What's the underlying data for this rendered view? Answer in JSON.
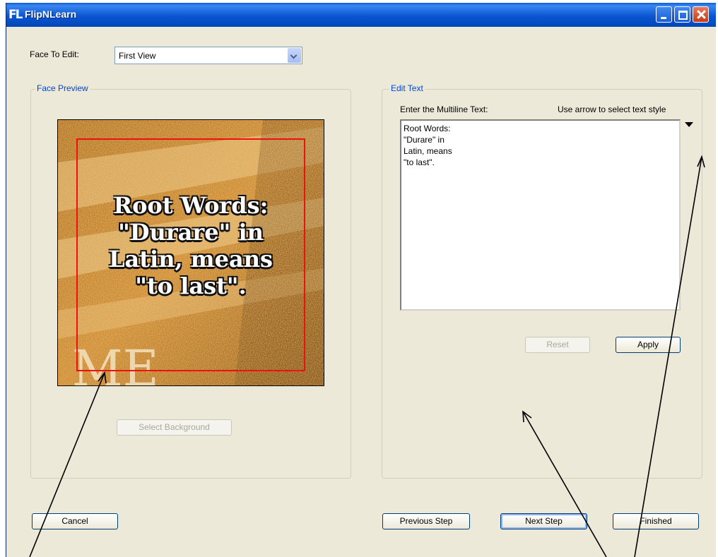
{
  "window": {
    "title": "FlipNLearn",
    "logo": "FL"
  },
  "face_to_edit": {
    "label": "Face To Edit:",
    "value": "First View"
  },
  "face_preview": {
    "legend": "Face Preview",
    "text_lines": [
      "Root Words:",
      "\"Durare\" in",
      "Latin, means",
      "\"to last\"."
    ],
    "select_background_label": "Select Background"
  },
  "edit_text": {
    "legend": "Edit Text",
    "multiline_label": "Enter the Multiline Text:",
    "style_hint": "Use arrow to select text style",
    "text_value": "Root Words:\n\"Durare\" in\nLatin, means\n\"to last\".",
    "reset_label": "Reset",
    "apply_label": "Apply"
  },
  "footer": {
    "cancel_label": "Cancel",
    "previous_label": "Previous Step",
    "next_label": "Next Step",
    "finished_label": "Finished"
  },
  "icons": {
    "minimize": "minimize-icon",
    "maximize": "maximize-icon",
    "close": "close-icon",
    "text_style_arrow": "dropdown-arrow-icon"
  },
  "colors": {
    "title_bar": "#0a5bd8",
    "dialog_bg": "#ece9d8",
    "group_legend": "#0046d5",
    "preview_frame": "#f01010"
  }
}
